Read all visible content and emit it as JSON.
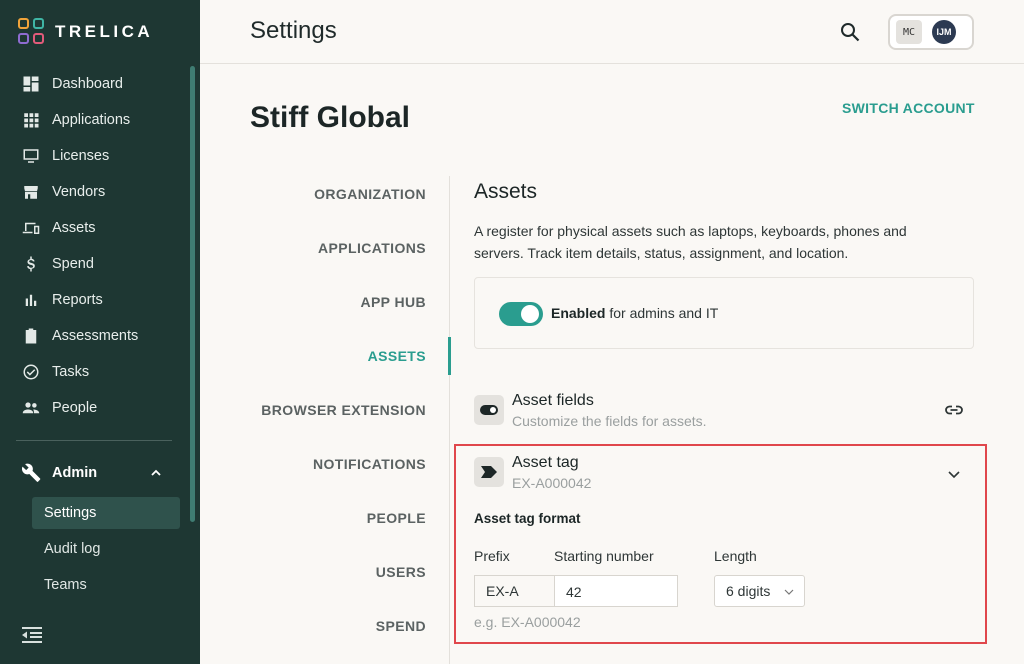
{
  "brand": {
    "name": "TRELICA"
  },
  "sidebar": {
    "items": [
      {
        "label": "Dashboard",
        "icon": "dashboard-icon"
      },
      {
        "label": "Applications",
        "icon": "grid-icon"
      },
      {
        "label": "Licenses",
        "icon": "monitor-icon"
      },
      {
        "label": "Vendors",
        "icon": "storefront-icon"
      },
      {
        "label": "Assets",
        "icon": "devices-icon"
      },
      {
        "label": "Spend",
        "icon": "dollar-icon"
      },
      {
        "label": "Reports",
        "icon": "bar-chart-icon"
      },
      {
        "label": "Assessments",
        "icon": "clipboard-icon"
      },
      {
        "label": "Tasks",
        "icon": "check-circle-icon"
      },
      {
        "label": "People",
        "icon": "people-icon"
      }
    ],
    "admin": {
      "label": "Admin",
      "sub_items": [
        {
          "label": "Settings",
          "active": true
        },
        {
          "label": "Audit log",
          "active": false
        },
        {
          "label": "Teams",
          "active": false
        }
      ]
    }
  },
  "header": {
    "title": "Settings",
    "avatars": [
      "MC",
      "IJM"
    ]
  },
  "account": {
    "name": "Stiff Global",
    "switch_label": "SWITCH ACCOUNT"
  },
  "subnav": {
    "items": [
      "ORGANIZATION",
      "APPLICATIONS",
      "APP HUB",
      "ASSETS",
      "BROWSER EXTENSION",
      "NOTIFICATIONS",
      "PEOPLE",
      "USERS",
      "SPEND"
    ],
    "active": "ASSETS"
  },
  "assets": {
    "title": "Assets",
    "description": "A register for physical assets such as laptops, keyboards, phones and servers. Track item details, status, assignment, and location.",
    "enabled_strong": "Enabled",
    "enabled_rest": " for admins and IT",
    "fields_row": {
      "title": "Asset fields",
      "subtitle": "Customize the fields for assets."
    },
    "tag_row": {
      "title": "Asset tag",
      "subtitle": "EX-A000042"
    },
    "tag_format": {
      "label": "Asset tag format",
      "prefix_label": "Prefix",
      "prefix_value": "EX-A",
      "start_label": "Starting number",
      "start_value": "42",
      "length_label": "Length",
      "length_value": "6 digits",
      "example": "e.g. EX-A000042"
    }
  },
  "colors": {
    "sidebar_bg": "#1e3733",
    "accent": "#2a9d8f",
    "highlight": "#e0474c"
  }
}
